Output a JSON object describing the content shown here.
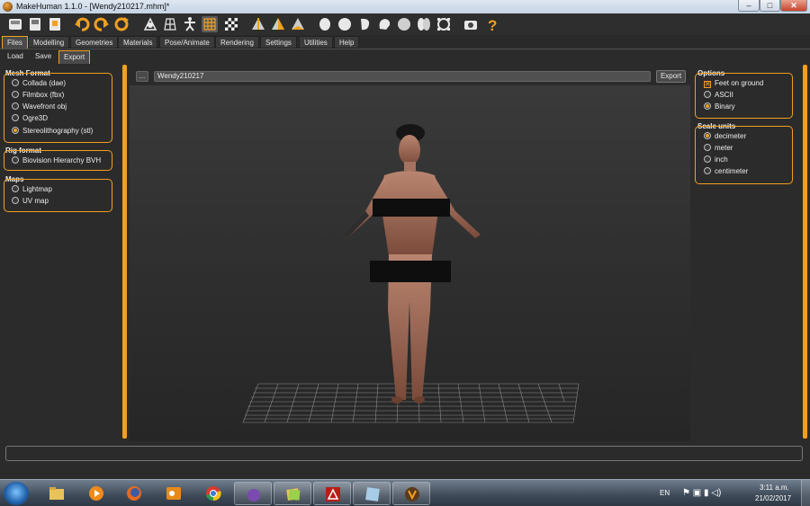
{
  "window": {
    "title": "MakeHuman 1.1.0 - [Wendy210217.mhm]*",
    "controls": [
      "–",
      "□",
      "✕"
    ]
  },
  "toolbar": {
    "icons": [
      "save-icon",
      "load-icon",
      "export-icon",
      "undo-icon",
      "redo-icon",
      "reset-icon",
      "smooth-icon",
      "wireframe-icon",
      "pose-icon",
      "grid-icon",
      "checker-icon",
      "front-view-icon",
      "side-view-icon",
      "top-view-icon",
      "face-icon",
      "sphere-icon",
      "profile-icon",
      "head-icon",
      "skeleton-icon",
      "rotate-icon",
      "screenshot-icon",
      "help-icon"
    ],
    "active": "grid-icon"
  },
  "tabs": [
    "Files",
    "Modelling",
    "Geometries",
    "Materials",
    "Pose/Animate",
    "Rendering",
    "Settings",
    "Utilities",
    "Help"
  ],
  "active_tab": "Files",
  "subtabs": [
    "Load",
    "Save",
    "Export"
  ],
  "active_subtab": "Export",
  "left_panel": {
    "mesh_format": {
      "title": "Mesh Format",
      "options": [
        "Collada (dae)",
        "Filmbox (fbx)",
        "Wavefront obj",
        "Ogre3D",
        "Stereolithography (stl)"
      ],
      "selected": "Stereolithography (stl)"
    },
    "rig_format": {
      "title": "Rig format",
      "options": [
        "Biovision Hierarchy BVH"
      ]
    },
    "maps": {
      "title": "Maps",
      "options": [
        "Lightmap",
        "UV map"
      ]
    }
  },
  "export_bar": {
    "browse_label": "...",
    "filename": "Wendy210217",
    "export_label": "Export"
  },
  "right_panel": {
    "options": {
      "title": "Options",
      "feet_on_ground": "Feet on ground",
      "feet_on_ground_checked": true,
      "formats": [
        "ASCII",
        "Binary"
      ],
      "selected_format": "Binary"
    },
    "scale_units": {
      "title": "Scale units",
      "options": [
        "decimeter",
        "meter",
        "inch",
        "centimeter"
      ],
      "selected": "decimeter"
    }
  },
  "taskbar": {
    "apps": [
      "explorer-icon",
      "firefox-icon",
      "media-player-icon",
      "outlook-icon",
      "chrome-icon",
      "purple-app-icon",
      "files-icon",
      "acrobat-icon",
      "notes-icon",
      "makehuman-icon"
    ],
    "open": [
      "purple-app-icon",
      "files-icon",
      "acrobat-icon",
      "notes-icon",
      "makehuman-icon"
    ],
    "language": "EN",
    "time": "3:11 a.m.",
    "date": "21/02/2017"
  },
  "colors": {
    "accent": "#f0a020",
    "background": "#2b2b2b",
    "viewport_top": "#3a3a3a",
    "viewport_bottom": "#262626"
  }
}
